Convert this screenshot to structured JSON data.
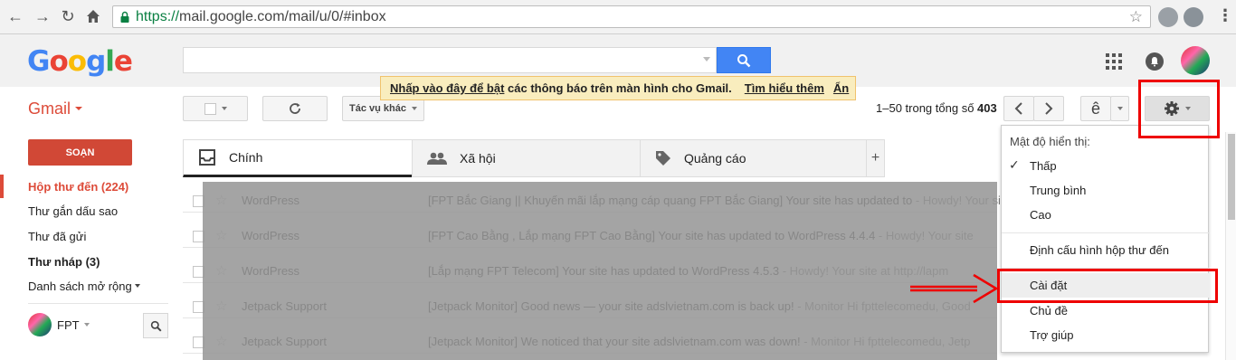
{
  "browser": {
    "url_scheme": "https://",
    "url_rest": "mail.google.com/mail/u/0/#inbox"
  },
  "header": {
    "logo_letters": [
      "G",
      "o",
      "o",
      "g",
      "l",
      "e"
    ],
    "logo_colors": [
      "#4285f4",
      "#ea4335",
      "#fbbc05",
      "#4285f4",
      "#34a853",
      "#ea4335"
    ],
    "search_placeholder": ""
  },
  "notification": {
    "link1": "Nhấp vào đây để bật",
    "text": " các thông báo trên màn hình cho Gmail.",
    "link2": "Tìm hiểu thêm",
    "link3": "Ẩn"
  },
  "toolbar": {
    "app_label": "Gmail",
    "more_actions": "Tác vụ khác",
    "count_prefix": "1–50 trong tổng số ",
    "count_total": "403",
    "input_tool_label": "ê"
  },
  "sidebar": {
    "compose_label": "SOẠN",
    "items": [
      {
        "label": "Hộp thư đến (224)"
      },
      {
        "label": "Thư gắn dấu sao"
      },
      {
        "label": "Thư đã gửi"
      },
      {
        "label": "Thư nháp (3)"
      },
      {
        "label": "Danh sách mở rộng"
      }
    ],
    "account_name": "FPT"
  },
  "tabs": [
    {
      "label": "Chính"
    },
    {
      "label": "Xã hội"
    },
    {
      "label": "Quảng cáo"
    }
  ],
  "emails": [
    {
      "sender": "WordPress",
      "subject": "[FPT Bắc Giang || Khuyến mãi lắp mạng cáp quang FPT Bắc Giang] Your site has updated to",
      "snippet": " - Howdy! Your site"
    },
    {
      "sender": "WordPress",
      "subject": "[FPT Cao Bằng , Lắp mạng FPT Cao Bằng] Your site has updated to WordPress 4.4.4",
      "snippet": " - Howdy! Your site"
    },
    {
      "sender": "WordPress",
      "subject": "[Lắp mạng FPT Telecom] Your site has updated to WordPress 4.5.3",
      "snippet": " - Howdy! Your site at http://lapm"
    },
    {
      "sender": "Jetpack Support",
      "subject": "[Jetpack Monitor] Good news — your site adslvietnam.com is back up!",
      "snippet": " - Monitor Hi fpttelecomedu, Good"
    },
    {
      "sender": "Jetpack Support",
      "subject": "[Jetpack Monitor] We noticed that your site adslvietnam.com was down!",
      "snippet": " - Monitor Hi fpttelecomedu, Jetp"
    }
  ],
  "settings_menu": {
    "density_header": "Mật độ hiển thị:",
    "density_options": [
      "Thấp",
      "Trung bình",
      "Cao"
    ],
    "selected_density": "Thấp",
    "configure_inbox": "Định cấu hình hộp thư đến",
    "settings": "Cài đặt",
    "themes": "Chủ đề",
    "help": "Trợ giúp"
  }
}
